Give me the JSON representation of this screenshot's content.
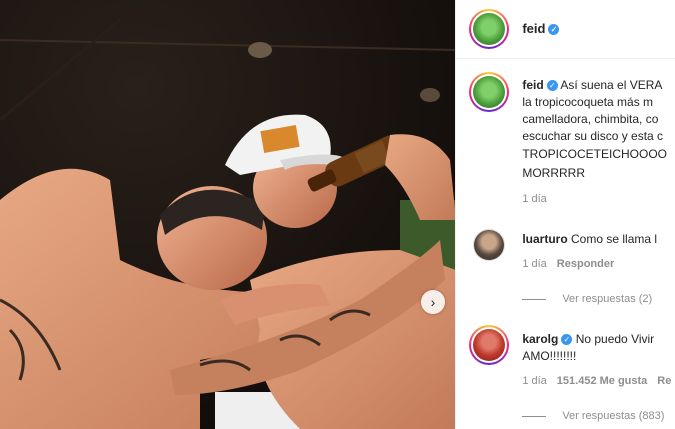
{
  "post": {
    "username": "feid",
    "caption_lines": [
      "Así suena el VERA",
      "la tropicocoqueta más m",
      "camelladora, chimbita, co",
      "escuchar su disco y esta c",
      "TROPICOCETEICHOOOO",
      "MORRRRR"
    ],
    "time": "1 día"
  },
  "comments": [
    {
      "username": "luarturo",
      "text": "Como se llama l",
      "time": "1 día",
      "reply_label": "Responder",
      "view_replies": "Ver respuestas (2)"
    },
    {
      "username": "karolg",
      "text_line1": "No puedo Vivir",
      "text_line2": "AMO!!!!!!!!",
      "time": "1 día",
      "likes": "151.452 Me gusta",
      "reply_label": "Re",
      "view_replies": "Ver respuestas (883)"
    }
  ],
  "colors": {
    "verified": "#3897f0",
    "feid_avatar": "#4a9b3a",
    "karol_avatar": "#c0392b"
  }
}
